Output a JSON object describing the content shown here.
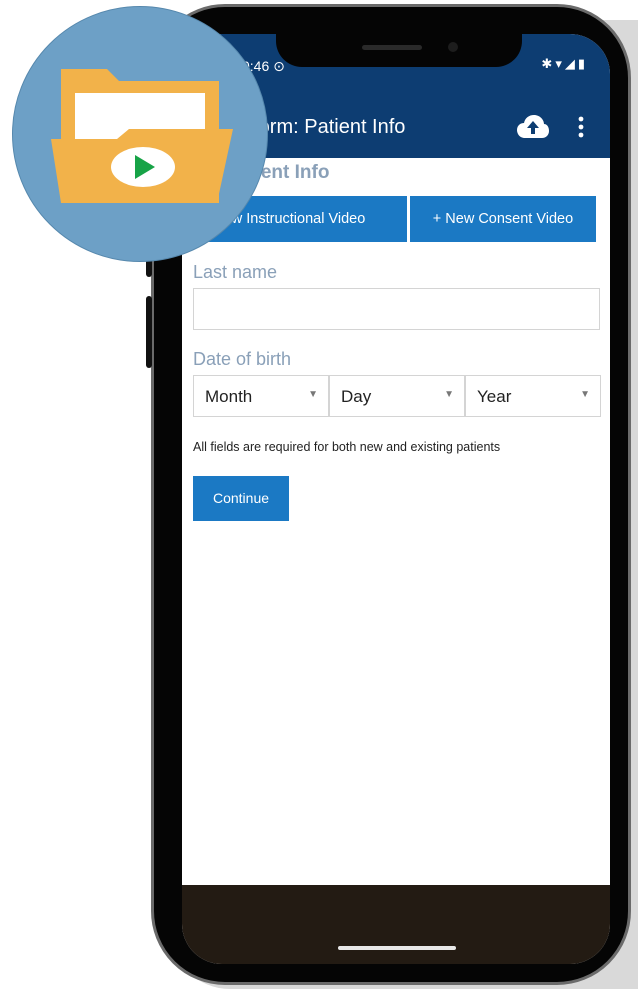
{
  "status_bar": {
    "time": "0:46 ⊙",
    "icons": "✱▾◢▮"
  },
  "app_bar": {
    "title": "nform: Patient Info",
    "upload_icon": "cloud-upload-icon",
    "more_icon": "more-vert-icon"
  },
  "section": {
    "title": "Patient Info"
  },
  "video_buttons": {
    "instructional_label": "ew Instructional Video",
    "consent_label": "+ New Consent Video"
  },
  "form": {
    "last_name_label": "Last name",
    "last_name_value": "",
    "dob_label": "Date of birth",
    "month_value": "Month",
    "day_value": "Day",
    "year_value": "Year",
    "note": "All fields are required for both new and existing patients",
    "continue_label": "Continue"
  },
  "colors": {
    "app_bar": "#0d3d72",
    "button": "#1b79c4",
    "label": "#8aa0b8",
    "nav_bar": "#231b13",
    "logo_circle": "#6da0c6",
    "folder": "#f2b24a",
    "play": "#17a347"
  },
  "logo": {
    "icon": "video-folder-icon"
  }
}
